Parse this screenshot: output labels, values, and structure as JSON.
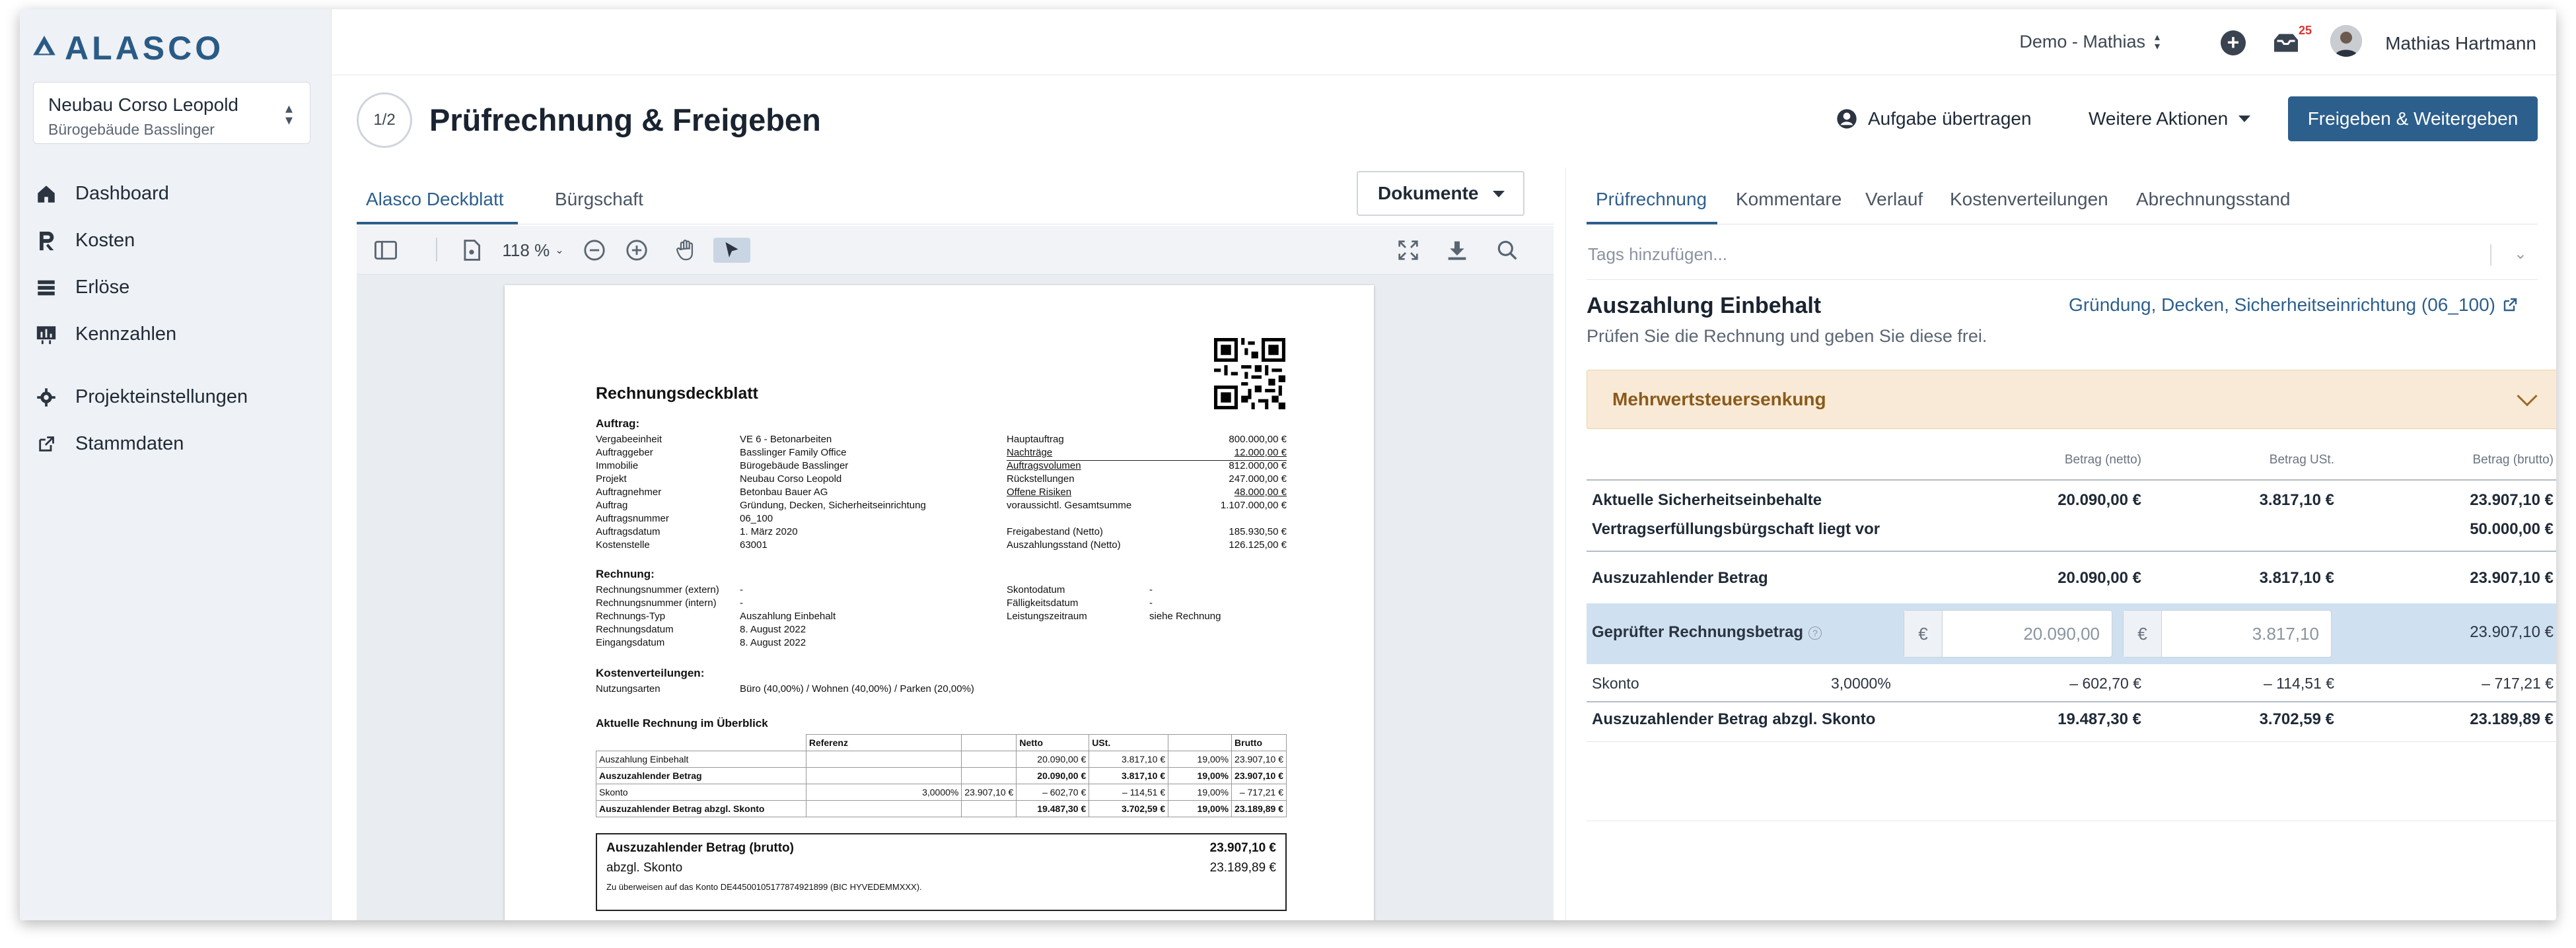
{
  "brand": {
    "logo_text": "ALASCO",
    "accent": "#2d5f8d"
  },
  "project": {
    "name": "Neubau Corso Leopold",
    "sub": "Bürogebäude Basslinger"
  },
  "sidebar": {
    "items": [
      {
        "label": "Dashboard",
        "icon": "home-icon"
      },
      {
        "label": "Kosten",
        "icon": "cost-icon"
      },
      {
        "label": "Erlöse",
        "icon": "revenue-icon"
      },
      {
        "label": "Kennzahlen",
        "icon": "metrics-icon"
      }
    ],
    "items2": [
      {
        "label": "Projekteinstellungen",
        "icon": "gear-icon"
      },
      {
        "label": "Stammdaten",
        "icon": "external-link-icon"
      }
    ]
  },
  "topbar": {
    "workspace": "Demo - Mathias",
    "badge": "25",
    "user": "Mathias Hartmann"
  },
  "header": {
    "step": "1/2",
    "title": "Prüfrechnung & Freigeben",
    "transfer": "Aufgabe übertragen",
    "more": "Weitere Aktionen",
    "primary": "Freigeben & Weitergeben"
  },
  "doc": {
    "tabs": [
      "Alasco Deckblatt",
      "Bürgschaft"
    ],
    "documents_button": "Dokumente",
    "zoom": "118 %"
  },
  "paper": {
    "title": "Rechnungsdeckblatt",
    "sec_auftrag": "Auftrag:",
    "auftrag_labels": [
      "Vergabeeinheit",
      "Auftraggeber",
      "Immobilie",
      "Projekt",
      "Auftragnehmer",
      "Auftrag",
      "Auftragsnummer",
      "Auftragsdatum",
      "Kostenstelle"
    ],
    "auftrag_values": [
      "VE 6 - Betonarbeiten",
      "Basslinger Family Office",
      "Bürogebäude Basslinger",
      "Neubau Corso Leopold",
      "Betonbau Bauer AG",
      "Gründung, Decken, Sicherheitseinrichtung",
      "06_100",
      "1. März 2020",
      "63001"
    ],
    "summary_labels": [
      "Hauptauftrag",
      "Nachträge",
      "Auftragsvolumen",
      "Rückstellungen",
      "Offene Risiken",
      "voraussichtl. Gesamtsumme"
    ],
    "summary_values": [
      "800.000,00 €",
      "12.000,00 €",
      "812.000,00 €",
      "247.000,00 €",
      "48.000,00 €",
      "1.107.000,00 €"
    ],
    "freigabe_labels": [
      "Freigabestand (Netto)",
      "Auszahlungsstand (Netto)"
    ],
    "freigabe_values": [
      "185.930,50 €",
      "126.125,00 €"
    ],
    "sec_rechnung": "Rechnung:",
    "rechnung_labels": [
      "Rechnungsnummer (extern)",
      "Rechnungsnummer (intern)",
      "Rechnungs-Typ",
      "Rechnungsdatum",
      "Eingangsdatum"
    ],
    "rechnung_values": [
      "-",
      "-",
      "Auszahlung Einbehalt",
      "8. August 2022",
      "8. August 2022"
    ],
    "rechnung2_labels": [
      "Skontodatum",
      "Fälligkeitsdatum",
      "Leistungszeitraum"
    ],
    "rechnung2_values": [
      "-",
      "-",
      "siehe Rechnung"
    ],
    "sec_kosten": "Kostenverteilungen:",
    "kosten_label": "Nutzungsarten",
    "kosten_value": "Büro (40,00%) / Wohnen (40,00%) / Parken (20,00%)",
    "sec_overview": "Aktuelle Rechnung im Überblick",
    "table_header": [
      "",
      "Referenz",
      "",
      "Netto",
      "USt.",
      "",
      "Brutto"
    ],
    "table_rows": [
      [
        "Auszahlung Einbehalt",
        "",
        "",
        "20.090,00 €",
        "3.817,10 €",
        "19,00%",
        "23.907,10 €"
      ],
      [
        "Auszuzahlender Betrag",
        "",
        "",
        "20.090,00 €",
        "3.817,10 €",
        "19,00%",
        "23.907,10 €"
      ],
      [
        "Skonto",
        "3,0000%",
        "23.907,10 €",
        "– 602,70 €",
        "– 114,51 €",
        "19,00%",
        "– 717,21 €"
      ],
      [
        "Auszuzahlender Betrag abzgl. Skonto",
        "",
        "",
        "19.487,30 €",
        "3.702,59 €",
        "19,00%",
        "23.189,89 €"
      ]
    ],
    "sum_label1": "Auszuzahlender Betrag (brutto)",
    "sum_value1": "23.907,10 €",
    "sum_label2": "abzgl. Skonto",
    "sum_value2": "23.189,89 €",
    "sum_note": "Zu überweisen auf das Konto DE44500105177874921899 (BIC HYVEDEMMXXX)."
  },
  "right": {
    "tabs": [
      "Prüfrechnung",
      "Kommentare",
      "Verlauf",
      "Kostenverteilungen",
      "Abrechnungsstand"
    ],
    "tags_placeholder": "Tags hinzufügen...",
    "title": "Auszahlung Einbehalt",
    "link": "Gründung, Decken, Sicherheitseinrichtung (06_100)",
    "subtitle": "Prüfen Sie die Rechnung und geben Sie diese frei.",
    "alert": "Mehrwertsteuersenkung",
    "col_net": "Betrag (netto)",
    "col_vat": "Betrag USt.",
    "col_gross": "Betrag (brutto)",
    "row1": {
      "label": "Aktuelle Sicherheitseinbehalte",
      "net": "20.090,00 €",
      "vat": "3.817,10 €",
      "gross": "23.907,10 €"
    },
    "row2": {
      "label": "Vertragserfüllungsbürgschaft liegt vor",
      "gross": "50.000,00 €"
    },
    "row3": {
      "label": "Auszuzahlender Betrag",
      "net": "20.090,00 €",
      "vat": "3.817,10 €",
      "gross": "23.907,10 €"
    },
    "checked": {
      "label": "Geprüfter Rechnungsbetrag",
      "currency": "€",
      "net_placeholder": "20.090,00",
      "vat_placeholder": "3.817,10",
      "gross": "23.907,10 €"
    },
    "skonto": {
      "label": "Skonto",
      "rate": "3,0000%",
      "net": "– 602,70 €",
      "vat": "– 114,51 €",
      "gross": "– 717,21 €"
    },
    "final": {
      "label": "Auszuzahlender Betrag abzgl. Skonto",
      "net": "19.487,30 €",
      "vat": "3.702,59 €",
      "gross": "23.189,89 €"
    }
  }
}
